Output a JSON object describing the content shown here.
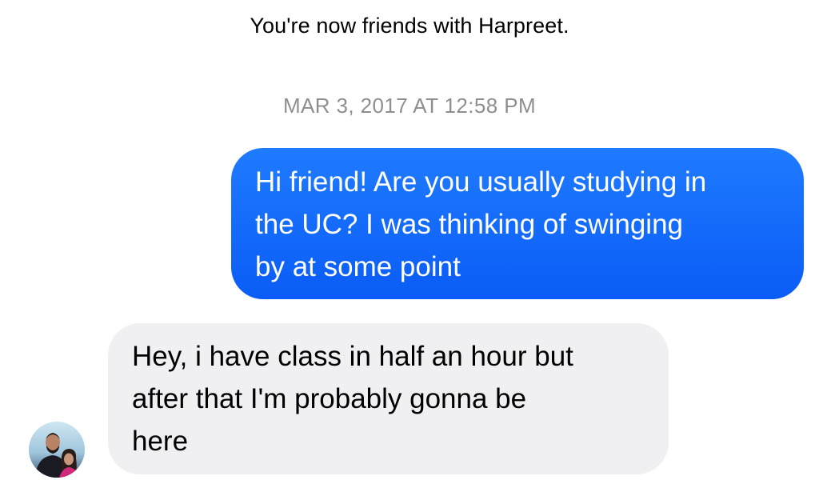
{
  "conversation": {
    "system_notice": "You're now friends with Harpreet.",
    "timestamp": "MAR 3, 2017 AT 12:58 PM",
    "messages": [
      {
        "direction": "outgoing",
        "lines": [
          "Hi friend! Are you usually studying in",
          "the UC? I was thinking of swinging",
          "by at some point"
        ]
      },
      {
        "direction": "incoming",
        "lines": [
          "Hey, i have class in half an hour but",
          "after that I'm probably gonna be",
          "here"
        ],
        "sender_avatar": "contact-photo"
      }
    ]
  },
  "colors": {
    "outgoing_bubble": "#0a5cf6",
    "incoming_bubble": "#f0f0f2",
    "timestamp_text": "#8e8e93"
  }
}
